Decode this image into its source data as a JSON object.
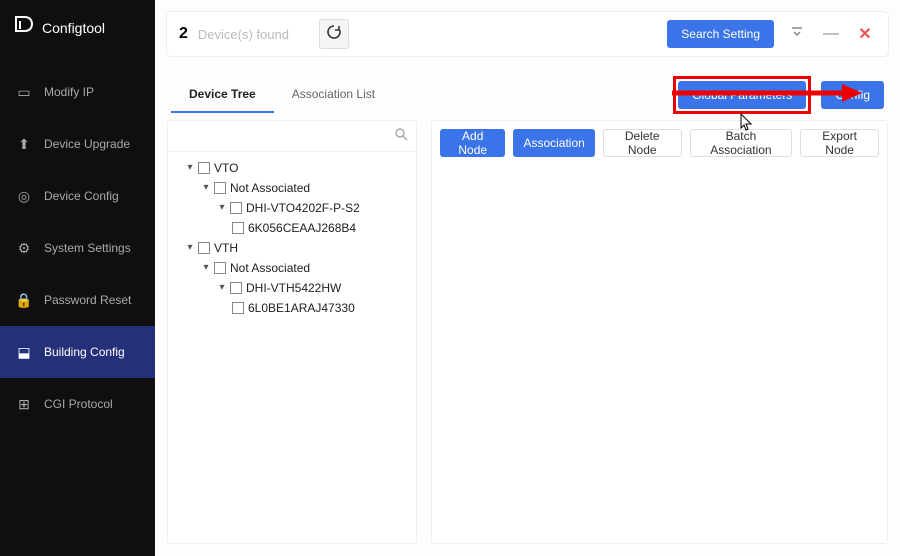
{
  "brand": "Configtool",
  "nav": {
    "modify_ip": "Modify IP",
    "device_upgrade": "Device Upgrade",
    "device_config": "Device Config",
    "system_settings": "System Settings",
    "password_reset": "Password Reset",
    "building_config": "Building Config",
    "cgi_protocol": "CGI Protocol"
  },
  "topbar": {
    "count": "2",
    "count_label": "Device(s) found",
    "search_setting": "Search Setting"
  },
  "tabs": {
    "device_tree": "Device Tree",
    "association_list": "Association List",
    "global_parameters": "Global Parameters",
    "config": "Config"
  },
  "actions": {
    "add_node": "Add Node",
    "association": "Association",
    "delete_node": "Delete Node",
    "batch_association": "Batch Association",
    "export_node": "Export Node"
  },
  "tree": {
    "vto": "VTO",
    "vto_na": "Not Associated",
    "vto_model": "DHI-VTO4202F-P-S2",
    "vto_serial": "6K056CEAAJ268B4",
    "vth": "VTH",
    "vth_na": "Not Associated",
    "vth_model": "DHI-VTH5422HW",
    "vth_serial": "6L0BE1ARAJ47330"
  },
  "search_placeholder": ""
}
